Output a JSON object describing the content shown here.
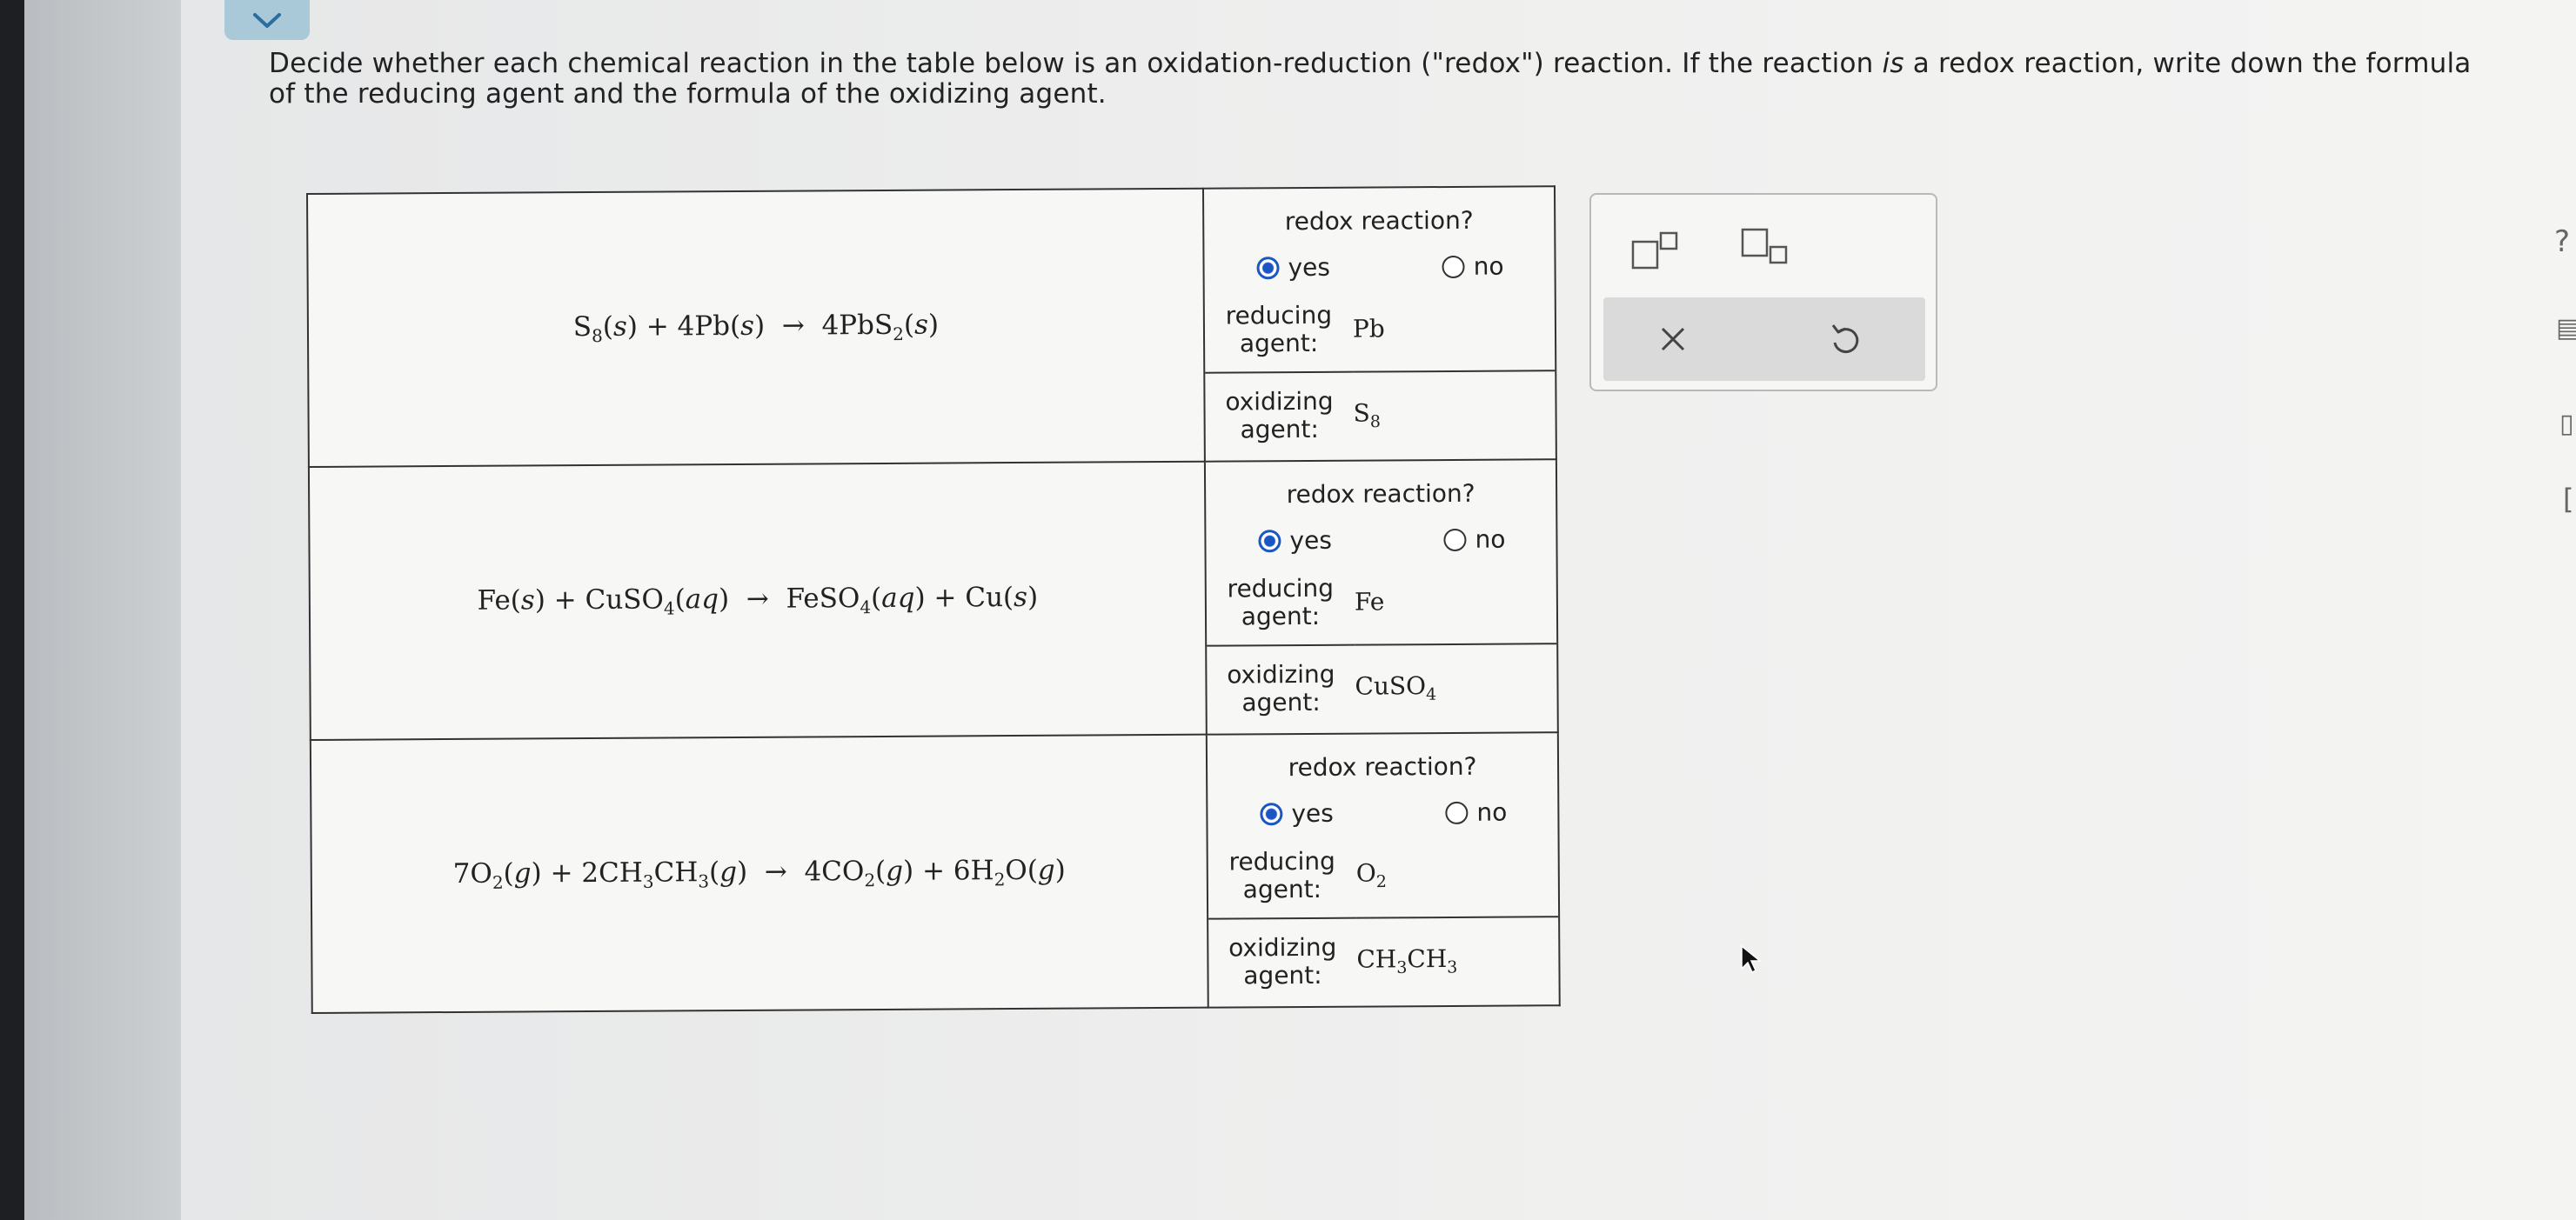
{
  "instructions": {
    "text_a": "Decide whether each chemical reaction in the table below is an oxidation-reduction (\"redox\") reaction. If the reaction ",
    "emph": "is",
    "text_b": " a redox reaction, write down the formula of the reducing agent and the formula of the oxidizing agent."
  },
  "labels": {
    "question": "redox reaction?",
    "yes": "yes",
    "no": "no",
    "reducing": "reducing agent:",
    "oxidizing": "oxidizing agent:"
  },
  "reactions": [
    {
      "equation": "S8(s) + 4Pb(s) → 4PbS2(s)",
      "redox": "yes",
      "reducing_agent": "Pb",
      "oxidizing_agent": "S8"
    },
    {
      "equation": "Fe(s) + CuSO4(aq) → FeSO4(aq) + Cu(s)",
      "redox": "yes",
      "reducing_agent": "Fe",
      "oxidizing_agent": "CuSO4"
    },
    {
      "equation": "7O2(g) + 2CH3CH3(g) → 4CO2(g) + 6H2O(g)",
      "redox": "yes",
      "reducing_agent": "O2",
      "oxidizing_agent": "CH3CH3"
    }
  ],
  "palette": {
    "tools": [
      "superscript-icon",
      "subscript-icon"
    ],
    "actions": [
      "clear-icon",
      "undo-icon"
    ]
  },
  "colors": {
    "accent": "#1a56c4",
    "chevron_button": "#a9c8d8"
  }
}
